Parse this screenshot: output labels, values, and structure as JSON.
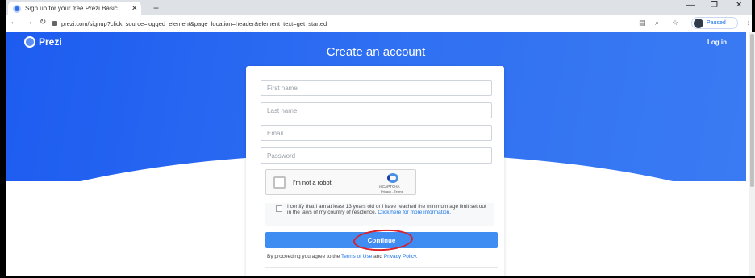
{
  "browser": {
    "tab_title": "Sign up for your free Prezi Basic",
    "tab_close": "✕",
    "new_tab": "+",
    "url": "prezi.com/signup?click_source=logged_element&page_location=header&element_text=get_started",
    "profile_label": "Paused",
    "window_controls": [
      "—",
      "❐",
      "✕"
    ]
  },
  "header": {
    "logo_text": "Prezi",
    "login": "Log in",
    "heading": "Create an account"
  },
  "form": {
    "first_name_placeholder": "First name",
    "last_name_placeholder": "Last name",
    "email_placeholder": "Email",
    "password_placeholder": "Password",
    "captcha_label": "I'm not a robot",
    "captcha_brand": "reCAPTCHA",
    "captcha_links": "Privacy - Terms",
    "certify_text": "I certify that I am at least 13 years old or I have reached the minimum age limit set out in the laws of my country of residence.",
    "certify_link": "Click here for more information.",
    "continue_label": "Continue",
    "terms_prefix": "By proceeding you agree to the",
    "terms_link": "Terms of Use",
    "terms_and": "and",
    "privacy_link": "Privacy Policy."
  },
  "colors": {
    "brand_blue": "#2f6ff2",
    "button_blue": "#3f8cf3",
    "annotation_red": "#d9202b"
  }
}
